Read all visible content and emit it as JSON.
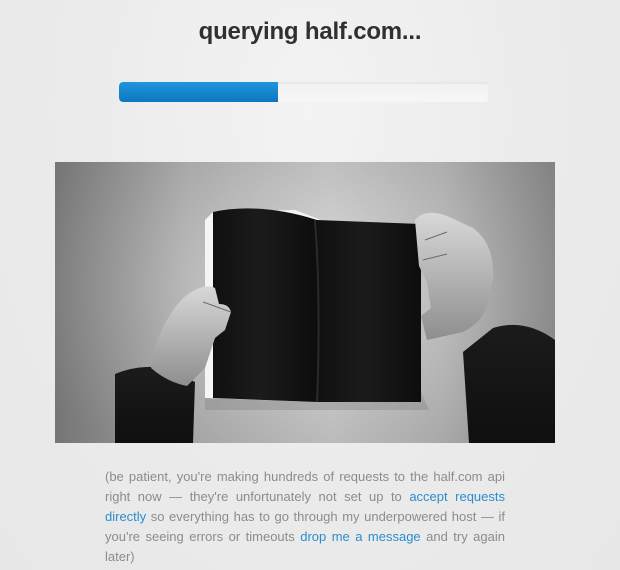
{
  "header": {
    "title": "querying half.com..."
  },
  "progress": {
    "value": 0.43,
    "fill_color": "#0f86d0",
    "track_color": "#f3f3f3"
  },
  "photo": {
    "subject": "hands holding a black open book",
    "icon": "photo"
  },
  "message": {
    "part1": "(be patient, you're making hundreds of requests to the half.com api right now — they're unfortunately not set up to ",
    "link1": "accept requests directly",
    "part2": " so everything has to go through my underpowered host — if you're seeing errors or timeouts ",
    "link2": "drop me a message",
    "part3": " and try again later)"
  },
  "colors": {
    "background": "#ececec",
    "title": "#303030",
    "text": "#8c8c8c",
    "link": "#2c8dcc"
  }
}
